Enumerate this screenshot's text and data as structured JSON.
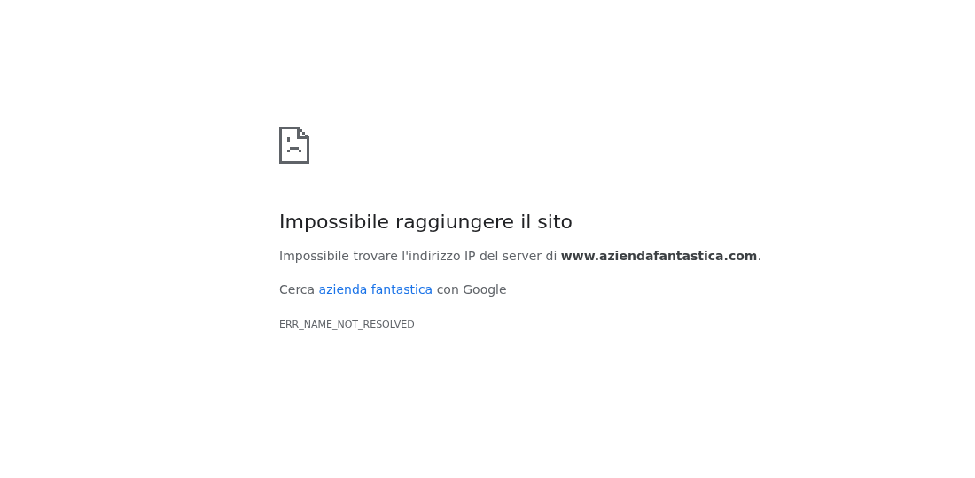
{
  "heading": "Impossibile raggiungere il sito",
  "message": "Impossibile trovare l'indirizzo IP del server di **www.aziendafantastica.com**.",
  "search": {
    "before": "Cerca",
    "link": "azienda fantastica",
    "after": "con Google"
  },
  "error_code": "ERR_NAME_NOT_RESOLVED"
}
